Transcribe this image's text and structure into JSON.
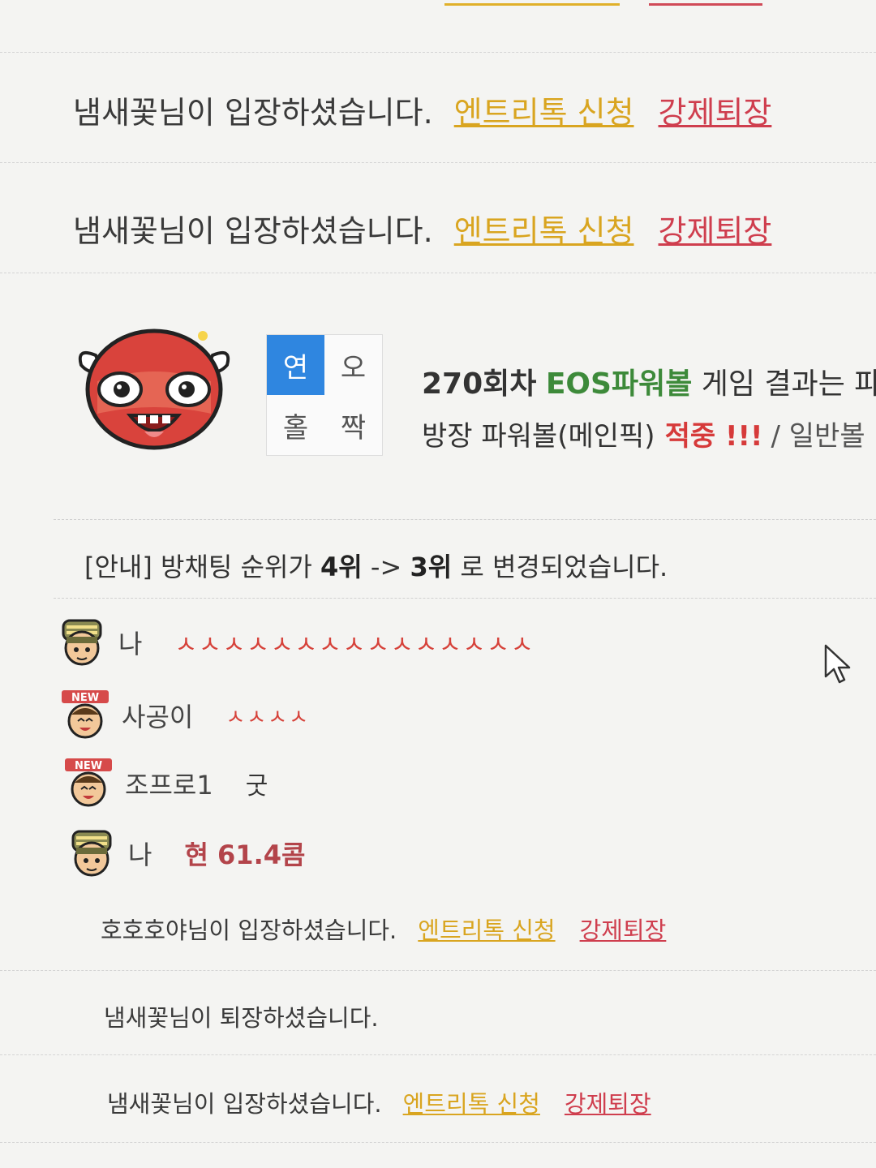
{
  "messages": [
    {
      "text": "냄새꽃님이 입장하셨습니다.",
      "entry": "엔트리톡 신청",
      "kick": "강제퇴장"
    },
    {
      "text": "냄새꽃님이 입장하셨습니다.",
      "entry": "엔트리톡 신청",
      "kick": "강제퇴장"
    }
  ],
  "result": {
    "grid": [
      "연",
      "오",
      "홀",
      "짝"
    ],
    "round": "270회차",
    "game": "EOS파워볼",
    "line1_rest": "게임 결과는 파",
    "line2_prefix": "방장 파워볼(메인픽)",
    "hit": "적중 !!!",
    "line2_suffix": "/ 일반볼"
  },
  "notice": {
    "prefix": "[안내] 방채팅 순위가",
    "from": "4위",
    "arrow": "->",
    "to": "3위",
    "suffix": "로 변경되었습니다."
  },
  "chats": [
    {
      "name": "나",
      "text": "ㅅㅅㅅㅅㅅㅅㅅㅅㅅㅅㅅㅅㅅㅅㅅ",
      "avatar": "soldier-avatar"
    },
    {
      "name": "사공이",
      "text": "ㅅㅅㅅㅅ",
      "avatar": "new-user-avatar"
    },
    {
      "name": "조프로1",
      "text": "굿",
      "avatar": "new-user-avatar"
    },
    {
      "name": "나",
      "text": "현 61.4콤",
      "avatar": "soldier-avatar"
    }
  ],
  "new_badge": "NEW",
  "bottom_messages": [
    {
      "text": "호호호야님이 입장하셨습니다.",
      "entry": "엔트리톡 신청",
      "kick": "강제퇴장"
    },
    {
      "text": "냄새꽃님이 퇴장하셨습니다."
    },
    {
      "text": "냄새꽃님이 입장하셨습니다.",
      "entry": "엔트리톡 신청",
      "kick": "강제퇴장"
    }
  ],
  "colors": {
    "entry_link": "#d9a520",
    "kick_link": "#cf3e4e",
    "selected_cell": "#2f86e0",
    "game_name": "#3d8a3a",
    "hit": "#d63a3a"
  }
}
